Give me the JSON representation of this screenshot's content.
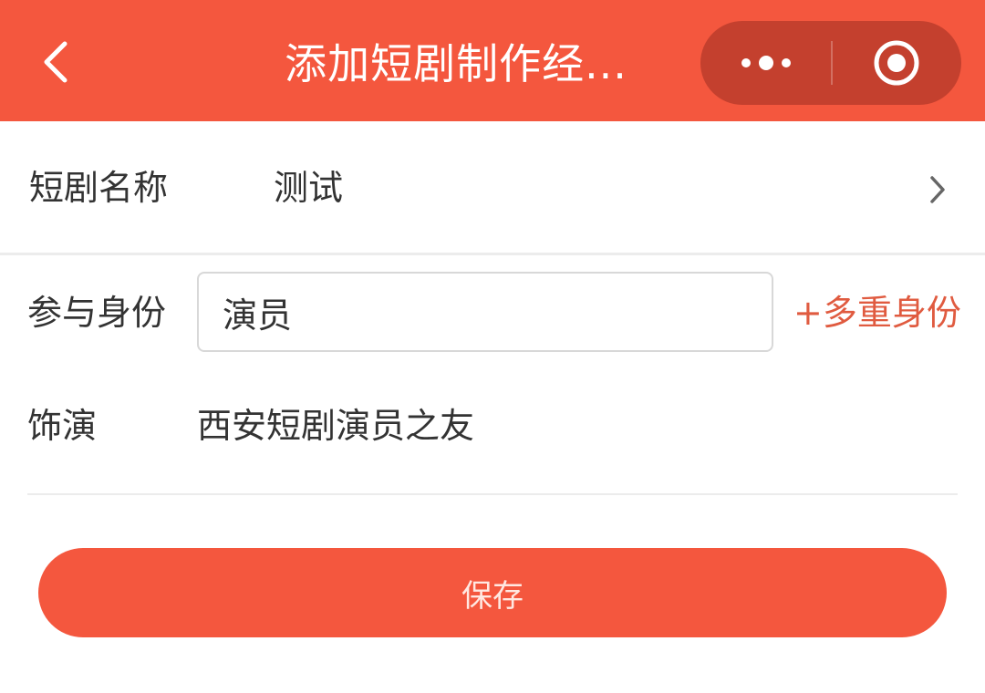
{
  "nav": {
    "title": "添加短剧制作经...",
    "back_icon": "chevron-left-icon",
    "more_icon": "more-dots-icon",
    "close_icon": "target-circle-icon",
    "background_color": "#F4573E"
  },
  "form": {
    "drama_name": {
      "label": "短剧名称",
      "value": "测试",
      "icon": "chevron-right-icon"
    },
    "role": {
      "label": "参与身份",
      "value": "演员",
      "add_label": "+多重身份"
    },
    "plays": {
      "label": "饰演",
      "value": "西安短剧演员之友"
    }
  },
  "actions": {
    "save_label": "保存"
  },
  "colors": {
    "accent": "#F4573E",
    "link": "#E05B40",
    "divider": "#ECECEC"
  }
}
